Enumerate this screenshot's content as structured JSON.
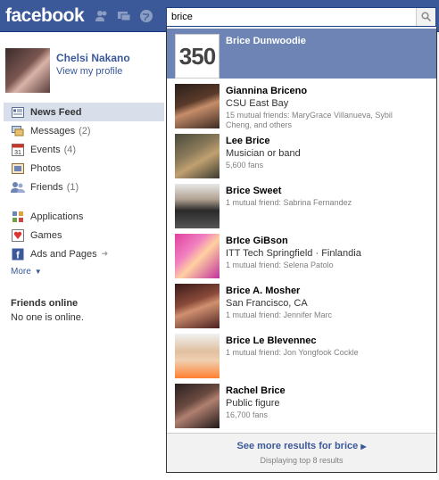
{
  "brand": {
    "logo": "facebook"
  },
  "search": {
    "value": "brice"
  },
  "profile": {
    "name": "Chelsi Nakano",
    "link": "View my profile"
  },
  "nav": {
    "items": [
      {
        "label": "News Feed",
        "count": "",
        "icon": "news-feed-icon"
      },
      {
        "label": "Messages",
        "count": "(2)",
        "icon": "messages-icon"
      },
      {
        "label": "Events",
        "count": "(4)",
        "icon": "events-icon"
      },
      {
        "label": "Photos",
        "count": "",
        "icon": "photos-icon"
      },
      {
        "label": "Friends",
        "count": "(1)",
        "icon": "friends-icon"
      }
    ],
    "apps": [
      {
        "label": "Applications",
        "icon": "applications-icon"
      },
      {
        "label": "Games",
        "icon": "games-icon"
      },
      {
        "label": "Ads and Pages",
        "icon": "ads-pages-icon"
      }
    ],
    "more": "More"
  },
  "friends_online": {
    "heading": "Friends online",
    "status": "No one is online."
  },
  "results": [
    {
      "name": "Brice Dunwoodie",
      "line1": "",
      "line2": "",
      "line3": "",
      "thumb_text": "350"
    },
    {
      "name": "Giannina Briceno",
      "line1": "CSU East Bay",
      "line2": "15 mutual friends: MaryGrace Villanueva, Sybil",
      "line3": "Cheng, and others"
    },
    {
      "name": "Lee Brice",
      "line1": "Musician or band",
      "line2": "5,600 fans",
      "line3": ""
    },
    {
      "name": "Brice Sweet",
      "line1": "",
      "line2": "1 mutual friend: Sabrina Fernandez",
      "line3": ""
    },
    {
      "name": "BrIce GiBson",
      "line1": "ITT Tech Springfield · Finlandia",
      "line2": "1 mutual friend: Selena Patolo",
      "line3": ""
    },
    {
      "name": "Brice A. Mosher",
      "line1": "San Francisco, CA",
      "line2": "1 mutual friend: Jennifer Marc",
      "line3": ""
    },
    {
      "name": "Brice Le Blevennec",
      "line1": "",
      "line2": "1 mutual friend: Jon Yongfook Cockle",
      "line3": ""
    },
    {
      "name": "Rachel Brice",
      "line1": "Public figure",
      "line2": "16,700 fans",
      "line3": ""
    }
  ],
  "see_more": {
    "label": "See more results for brice",
    "sub": "Displaying top 8 results"
  }
}
